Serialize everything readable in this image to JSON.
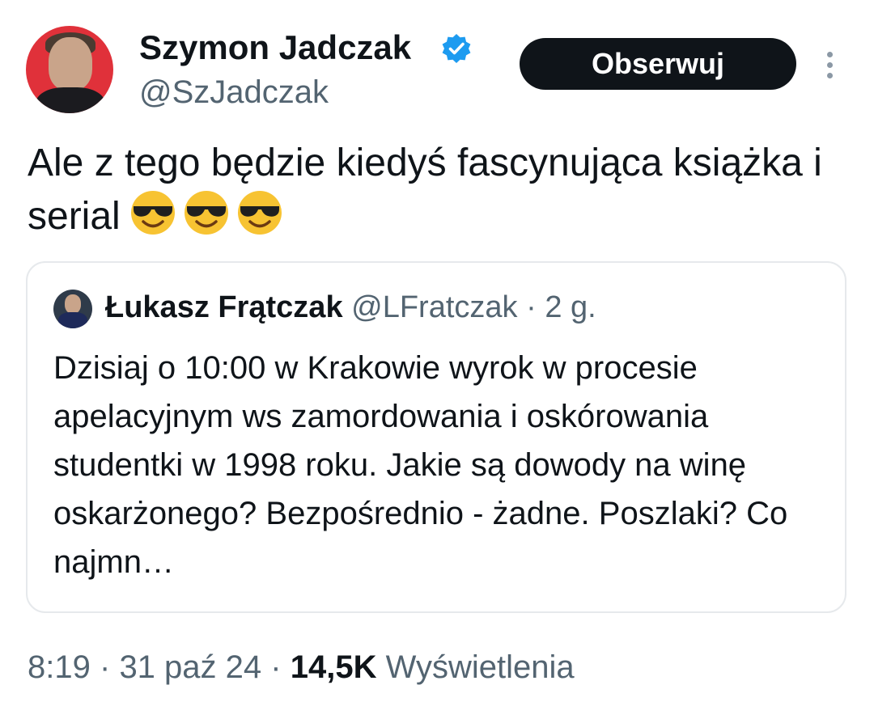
{
  "author": {
    "display_name": "Szymon Jadczak",
    "handle": "@SzJadczak",
    "verified": true
  },
  "actions": {
    "follow_label": "Obserwuj"
  },
  "tweet": {
    "text": "Ale z tego będzie kiedyś fascynująca książka i serial",
    "emojis": [
      "smiling-face-with-sunglasses",
      "smiling-face-with-sunglasses",
      "smiling-face-with-sunglasses"
    ]
  },
  "quoted": {
    "display_name": "Łukasz Frątczak",
    "handle": "@LFratczak",
    "separator": "·",
    "time": "2 g.",
    "text": "Dzisiaj o 10:00 w Krakowie wyrok w procesie apelacyjnym ws zamordowania i oskórowania studentki w 1998 roku. Jakie są dowody na winę oskarżonego? Bezpośrednio - żadne. Poszlaki? Co najmn…"
  },
  "footer": {
    "time": "8:19",
    "date": "31 paź 24",
    "separator": "·",
    "views_count": "14,5K",
    "views_label": "Wyświetlenia"
  },
  "colors": {
    "text_primary": "#0f1419",
    "text_secondary": "#536471",
    "verified_badge": "#1d9bf0",
    "follow_button": "#0f1419",
    "avatar_bg": "#e0313a",
    "border": "#e6e9ec"
  }
}
